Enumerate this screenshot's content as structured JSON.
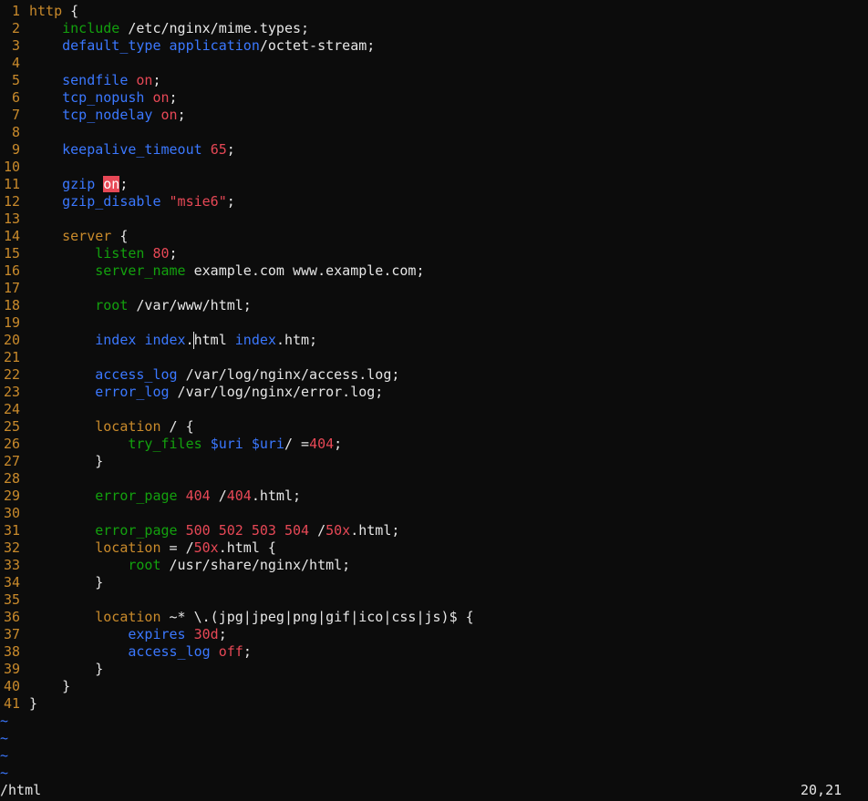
{
  "editor": {
    "lines": [
      {
        "n": "1",
        "t": [
          {
            "c": "c-kw",
            "s": "http"
          },
          {
            "c": "c-plain",
            "s": " {"
          }
        ]
      },
      {
        "n": "2",
        "t": [
          {
            "c": "c-plain",
            "s": "    "
          },
          {
            "c": "c-dir-green",
            "s": "include"
          },
          {
            "c": "c-plain",
            "s": " /etc/nginx/mime.types;"
          }
        ]
      },
      {
        "n": "3",
        "t": [
          {
            "c": "c-plain",
            "s": "    "
          },
          {
            "c": "c-dir-blue",
            "s": "default_type"
          },
          {
            "c": "c-plain",
            "s": " "
          },
          {
            "c": "c-var",
            "s": "application"
          },
          {
            "c": "c-plain",
            "s": "/octet-stream;"
          }
        ]
      },
      {
        "n": "4",
        "t": []
      },
      {
        "n": "5",
        "t": [
          {
            "c": "c-plain",
            "s": "    "
          },
          {
            "c": "c-dir-blue",
            "s": "sendfile"
          },
          {
            "c": "c-plain",
            "s": " "
          },
          {
            "c": "c-num",
            "s": "on"
          },
          {
            "c": "c-plain",
            "s": ";"
          }
        ]
      },
      {
        "n": "6",
        "t": [
          {
            "c": "c-plain",
            "s": "    "
          },
          {
            "c": "c-dir-blue",
            "s": "tcp_nopush"
          },
          {
            "c": "c-plain",
            "s": " "
          },
          {
            "c": "c-num",
            "s": "on"
          },
          {
            "c": "c-plain",
            "s": ";"
          }
        ]
      },
      {
        "n": "7",
        "t": [
          {
            "c": "c-plain",
            "s": "    "
          },
          {
            "c": "c-dir-blue",
            "s": "tcp_nodelay"
          },
          {
            "c": "c-plain",
            "s": " "
          },
          {
            "c": "c-num",
            "s": "on"
          },
          {
            "c": "c-plain",
            "s": ";"
          }
        ]
      },
      {
        "n": "8",
        "t": []
      },
      {
        "n": "9",
        "t": [
          {
            "c": "c-plain",
            "s": "    "
          },
          {
            "c": "c-dir-blue",
            "s": "keepalive_timeout"
          },
          {
            "c": "c-plain",
            "s": " "
          },
          {
            "c": "c-num",
            "s": "65"
          },
          {
            "c": "c-plain",
            "s": ";"
          }
        ]
      },
      {
        "n": "10",
        "t": []
      },
      {
        "n": "11",
        "t": [
          {
            "c": "c-plain",
            "s": "    "
          },
          {
            "c": "c-dir-blue",
            "s": "gzip"
          },
          {
            "c": "c-plain",
            "s": " "
          },
          {
            "c": "search-hl",
            "s": "on"
          },
          {
            "c": "c-plain",
            "s": ";"
          }
        ]
      },
      {
        "n": "12",
        "t": [
          {
            "c": "c-plain",
            "s": "    "
          },
          {
            "c": "c-dir-blue",
            "s": "gzip_disable"
          },
          {
            "c": "c-plain",
            "s": " "
          },
          {
            "c": "c-str",
            "s": "\"msie6\""
          },
          {
            "c": "c-plain",
            "s": ";"
          }
        ]
      },
      {
        "n": "13",
        "t": []
      },
      {
        "n": "14",
        "t": [
          {
            "c": "c-plain",
            "s": "    "
          },
          {
            "c": "c-kw",
            "s": "server"
          },
          {
            "c": "c-plain",
            "s": " {"
          }
        ]
      },
      {
        "n": "15",
        "t": [
          {
            "c": "c-plain",
            "s": "        "
          },
          {
            "c": "c-dir-green",
            "s": "listen"
          },
          {
            "c": "c-plain",
            "s": " "
          },
          {
            "c": "c-num",
            "s": "80"
          },
          {
            "c": "c-plain",
            "s": ";"
          }
        ]
      },
      {
        "n": "16",
        "t": [
          {
            "c": "c-plain",
            "s": "        "
          },
          {
            "c": "c-dir-green",
            "s": "server_name"
          },
          {
            "c": "c-plain",
            "s": " example.com www.example.com;"
          }
        ]
      },
      {
        "n": "17",
        "t": []
      },
      {
        "n": "18",
        "t": [
          {
            "c": "c-plain",
            "s": "        "
          },
          {
            "c": "c-dir-green",
            "s": "root"
          },
          {
            "c": "c-plain",
            "s": " /var/www/html;"
          }
        ]
      },
      {
        "n": "19",
        "t": []
      },
      {
        "n": "20",
        "t": [
          {
            "c": "c-plain",
            "s": "        "
          },
          {
            "c": "c-dir-blue",
            "s": "index"
          },
          {
            "c": "c-plain",
            "s": " "
          },
          {
            "c": "c-var",
            "s": "index"
          },
          {
            "c": "c-plain",
            "s": "."
          },
          {
            "c": "cursor",
            "s": "h"
          },
          {
            "c": "c-plain",
            "s": "tml "
          },
          {
            "c": "c-var",
            "s": "index"
          },
          {
            "c": "c-plain",
            "s": ".htm;"
          }
        ]
      },
      {
        "n": "21",
        "t": []
      },
      {
        "n": "22",
        "t": [
          {
            "c": "c-plain",
            "s": "        "
          },
          {
            "c": "c-dir-blue",
            "s": "access_log"
          },
          {
            "c": "c-plain",
            "s": " /var/log/nginx/access.log;"
          }
        ]
      },
      {
        "n": "23",
        "t": [
          {
            "c": "c-plain",
            "s": "        "
          },
          {
            "c": "c-dir-blue",
            "s": "error_log"
          },
          {
            "c": "c-plain",
            "s": " /var/log/nginx/error.log;"
          }
        ]
      },
      {
        "n": "24",
        "t": []
      },
      {
        "n": "25",
        "t": [
          {
            "c": "c-plain",
            "s": "        "
          },
          {
            "c": "c-kw",
            "s": "location"
          },
          {
            "c": "c-plain",
            "s": " / {"
          }
        ]
      },
      {
        "n": "26",
        "t": [
          {
            "c": "c-plain",
            "s": "            "
          },
          {
            "c": "c-dir-green",
            "s": "try_files"
          },
          {
            "c": "c-plain",
            "s": " "
          },
          {
            "c": "c-var",
            "s": "$uri"
          },
          {
            "c": "c-plain",
            "s": " "
          },
          {
            "c": "c-var",
            "s": "$uri"
          },
          {
            "c": "c-plain",
            "s": "/ ="
          },
          {
            "c": "c-num",
            "s": "404"
          },
          {
            "c": "c-plain",
            "s": ";"
          }
        ]
      },
      {
        "n": "27",
        "t": [
          {
            "c": "c-plain",
            "s": "        }"
          }
        ]
      },
      {
        "n": "28",
        "t": []
      },
      {
        "n": "29",
        "t": [
          {
            "c": "c-plain",
            "s": "        "
          },
          {
            "c": "c-dir-green",
            "s": "error_page"
          },
          {
            "c": "c-plain",
            "s": " "
          },
          {
            "c": "c-num",
            "s": "404"
          },
          {
            "c": "c-plain",
            "s": " /"
          },
          {
            "c": "c-num",
            "s": "404"
          },
          {
            "c": "c-plain",
            "s": ".html;"
          }
        ]
      },
      {
        "n": "30",
        "t": []
      },
      {
        "n": "31",
        "t": [
          {
            "c": "c-plain",
            "s": "        "
          },
          {
            "c": "c-dir-green",
            "s": "error_page"
          },
          {
            "c": "c-plain",
            "s": " "
          },
          {
            "c": "c-num",
            "s": "500 502 503 504"
          },
          {
            "c": "c-plain",
            "s": " /"
          },
          {
            "c": "c-num",
            "s": "50x"
          },
          {
            "c": "c-plain",
            "s": ".html;"
          }
        ]
      },
      {
        "n": "32",
        "t": [
          {
            "c": "c-plain",
            "s": "        "
          },
          {
            "c": "c-kw",
            "s": "location"
          },
          {
            "c": "c-plain",
            "s": " = /"
          },
          {
            "c": "c-num",
            "s": "50x"
          },
          {
            "c": "c-plain",
            "s": ".html {"
          }
        ]
      },
      {
        "n": "33",
        "t": [
          {
            "c": "c-plain",
            "s": "            "
          },
          {
            "c": "c-dir-green",
            "s": "root"
          },
          {
            "c": "c-plain",
            "s": " /usr/share/nginx/html;"
          }
        ]
      },
      {
        "n": "34",
        "t": [
          {
            "c": "c-plain",
            "s": "        }"
          }
        ]
      },
      {
        "n": "35",
        "t": []
      },
      {
        "n": "36",
        "t": [
          {
            "c": "c-plain",
            "s": "        "
          },
          {
            "c": "c-kw",
            "s": "location"
          },
          {
            "c": "c-plain",
            "s": " ~* \\.(jpg|jpeg|png|gif|ico|css|js)$ {"
          }
        ]
      },
      {
        "n": "37",
        "t": [
          {
            "c": "c-plain",
            "s": "            "
          },
          {
            "c": "c-dir-blue",
            "s": "expires"
          },
          {
            "c": "c-plain",
            "s": " "
          },
          {
            "c": "c-num",
            "s": "30d"
          },
          {
            "c": "c-plain",
            "s": ";"
          }
        ]
      },
      {
        "n": "38",
        "t": [
          {
            "c": "c-plain",
            "s": "            "
          },
          {
            "c": "c-dir-blue",
            "s": "access_log"
          },
          {
            "c": "c-plain",
            "s": " "
          },
          {
            "c": "c-num",
            "s": "off"
          },
          {
            "c": "c-plain",
            "s": ";"
          }
        ]
      },
      {
        "n": "39",
        "t": [
          {
            "c": "c-plain",
            "s": "        }"
          }
        ]
      },
      {
        "n": "40",
        "t": [
          {
            "c": "c-plain",
            "s": "    }"
          }
        ]
      },
      {
        "n": "41",
        "t": [
          {
            "c": "c-plain",
            "s": "}"
          }
        ]
      }
    ],
    "tilde_lines": [
      "~",
      "~",
      "~",
      "~"
    ]
  },
  "status": {
    "command": "/html",
    "position": "20,21"
  },
  "colors": {
    "background": "#0c0c0c",
    "line_number": "#c98a2b",
    "keyword": "#c98a2b",
    "directive_green": "#13a10e",
    "directive_blue": "#3b78ff",
    "number": "#e74856",
    "search_highlight": "#e74856",
    "tilde": "#3b78ff"
  }
}
